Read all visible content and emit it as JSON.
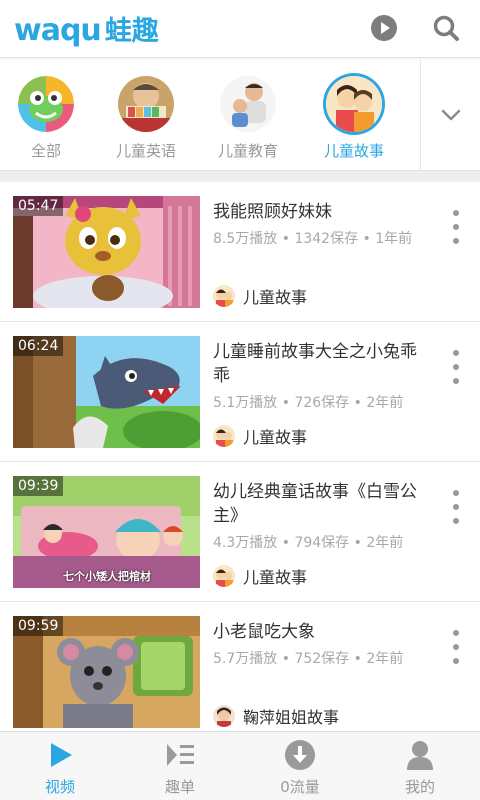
{
  "header": {
    "logo_en": "waqu",
    "logo_cn": "蛙趣"
  },
  "categories": [
    {
      "label": "全部",
      "active": false
    },
    {
      "label": "儿童英语",
      "active": false
    },
    {
      "label": "儿童教育",
      "active": false
    },
    {
      "label": "儿童故事",
      "active": true
    }
  ],
  "videos": [
    {
      "duration": "05:47",
      "title": "我能照顾好妹妹",
      "plays": "8.5万播放",
      "saves": "1342保存",
      "age": "1年前",
      "channel": "儿童故事"
    },
    {
      "duration": "06:24",
      "title": "儿童睡前故事大全之小兔乖乖",
      "plays": "5.1万播放",
      "saves": "726保存",
      "age": "2年前",
      "channel": "儿童故事"
    },
    {
      "duration": "09:39",
      "title": "幼儿经典童话故事《白雪公主》",
      "plays": "4.3万播放",
      "saves": "794保存",
      "age": "2年前",
      "channel": "儿童故事"
    },
    {
      "duration": "09:59",
      "title": "小老鼠吃大象",
      "plays": "5.7万播放",
      "saves": "752保存",
      "age": "2年前",
      "channel": "鞠萍姐姐故事"
    }
  ],
  "thumb_captions": {
    "v3": "七个小矮人把棺材"
  },
  "meta_separator": "•",
  "bottom_nav": [
    {
      "label": "视频",
      "active": true
    },
    {
      "label": "趣单",
      "active": false
    },
    {
      "label": "0流量",
      "active": false
    },
    {
      "label": "我的",
      "active": false
    }
  ],
  "colors": {
    "accent": "#2aa7e3",
    "inactive": "#9a9a9a"
  }
}
